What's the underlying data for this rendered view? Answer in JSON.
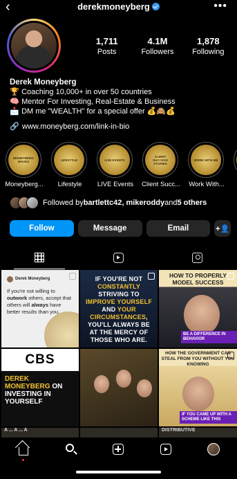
{
  "header": {
    "username": "derekmoneyberg",
    "back_icon": "chevron-left-icon",
    "more_icon": "more-horizontal-icon"
  },
  "stats": [
    {
      "value": "1,711",
      "label": "Posts"
    },
    {
      "value": "4.1M",
      "label": "Followers"
    },
    {
      "value": "1,878",
      "label": "Following"
    }
  ],
  "bio": {
    "name": "Derek Moneyberg",
    "lines": [
      {
        "icon": "🏆",
        "text": "Coaching 10,000+ in over 50 countries"
      },
      {
        "icon": "🧠",
        "text": "Mentor For Investing, Real-Estate & Business"
      },
      {
        "icon": "📩",
        "text": "DM me \"WEALTH\" for a special offer 💰🙈💰"
      }
    ],
    "link": "www.moneyberg.com/link-in-bio"
  },
  "highlights": [
    {
      "label": "Moneyberg...",
      "cover": "MONEYBERG MOVES"
    },
    {
      "label": "Lifestyle",
      "cover": "LIFESTYLE"
    },
    {
      "label": "LIVE Events",
      "cover": "LIVE EVENTS"
    },
    {
      "label": "Client Succ...",
      "cover": "CLIENT SUCCESS STORIES"
    },
    {
      "label": "Work With...",
      "cover": "WORK WITH ME"
    }
  ],
  "followed_by": {
    "prefix": "Followed by ",
    "names": "bartlettc42, mikeroddy",
    "suffix_and": " and ",
    "others": "5 others"
  },
  "actions": {
    "follow": "Follow",
    "message": "Message",
    "email": "Email",
    "add_icon": "add-person-icon"
  },
  "tabs": [
    "grid-icon",
    "reels-icon",
    "tagged-icon"
  ],
  "posts": {
    "p1_author": "Derek Moneyberg",
    "p1_quote_a": "If you're not willing to ",
    "p1_quote_b": "outwork",
    "p1_quote_c": " others, accept that others will ",
    "p1_quote_d": "always",
    "p1_quote_e": " have better results than you.",
    "p2_a": "IF YOU'RE NOT ",
    "p2_b": "CONSTANTLY",
    "p2_c": " STRIVING TO ",
    "p2_d": "IMPROVE YOURSELF",
    "p2_e": " AND ",
    "p2_f": "YOUR CIRCUMSTANCES",
    "p2_g": ", YOU'LL ALWAYS BE AT THE MERCY OF THOSE WHO ARE.",
    "p3_head": "HOW TO PROPERLY MODEL SUCCESS",
    "p3_cap": "BE A DIFFERENCE IN BEHAVIOR",
    "p4_logo": "CBS",
    "p4_a": "DEREK MONEYBERG",
    "p4_b": " ON INVESTING IN YOURSELF",
    "p6_head": "HOW THE GOVERNMENT CAN STEAL FROM YOU WITHOUT YOU KNOWING",
    "p6_cap": "IF YOU CAME UP WITH A SCHEME LIKE THIS",
    "peek_1": "A ... A ... A",
    "peek_2": "",
    "peek_3": "DISTRIBUTIVE"
  },
  "bottom_nav": [
    "home-icon",
    "search-icon",
    "create-icon",
    "reels-icon",
    "profile-icon"
  ]
}
